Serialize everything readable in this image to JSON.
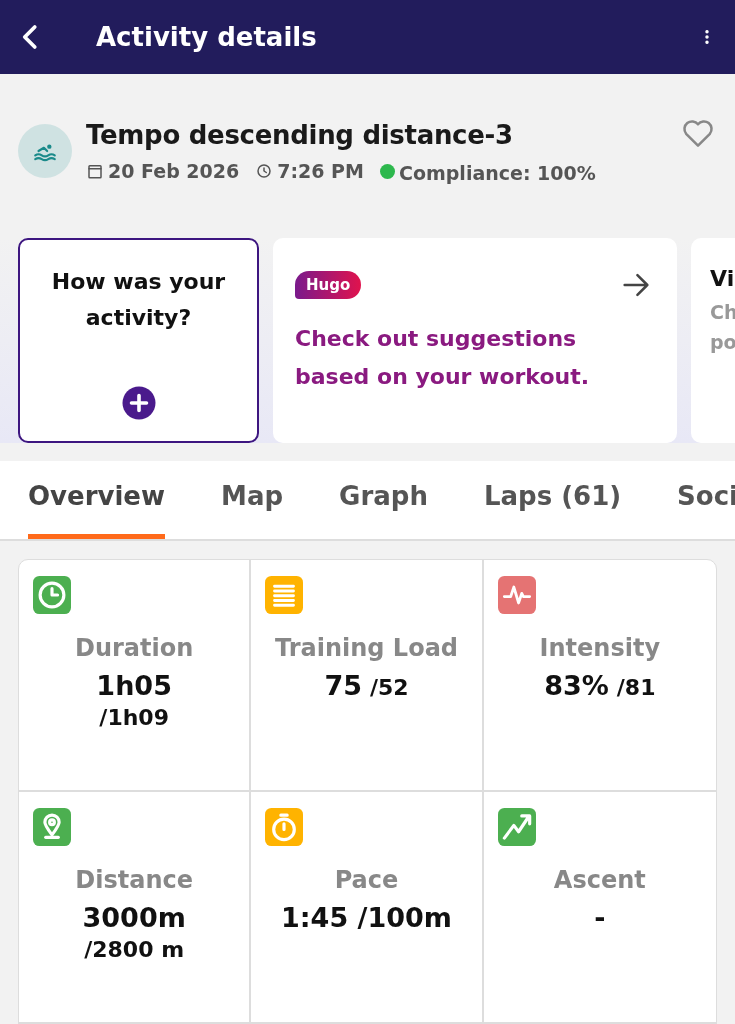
{
  "header": {
    "title": "Activity details"
  },
  "activity": {
    "title": "Tempo descending distance-3",
    "date": "20 Feb 2026",
    "time": "7:26 PM",
    "compliance": "Compliance: 100%",
    "favorite": false
  },
  "cards": [
    {
      "kind": "feedback",
      "title": "How was your activity?"
    },
    {
      "kind": "suggestion",
      "badge": "Hugo",
      "text": "Check out suggestions based on your workout."
    },
    {
      "kind": "partial",
      "title": "Vi",
      "lines": [
        "Ch",
        "po"
      ]
    }
  ],
  "tabs": [
    {
      "label": "Overview",
      "selected": true
    },
    {
      "label": "Map",
      "selected": false
    },
    {
      "label": "Graph",
      "selected": false
    },
    {
      "label": "Laps (61)",
      "selected": false
    },
    {
      "label": "Soci",
      "selected": false
    }
  ],
  "metrics": [
    {
      "color": "#4caf50",
      "label": "Duration",
      "value": "1h05",
      "target": "/1h09",
      "kind": "stacked"
    },
    {
      "color": "#ffb300",
      "label": "Training Load",
      "value": "75",
      "target": "/52",
      "kind": "inline"
    },
    {
      "color": "#e57373",
      "label": "Intensity",
      "value": "83%",
      "target": "/81",
      "kind": "inline"
    },
    {
      "color": "#4caf50",
      "label": "Distance",
      "value": "3000m",
      "target": "/2800 m",
      "kind": "stacked"
    },
    {
      "color": "#ffb300",
      "label": "Pace",
      "value": "1:45 /100m",
      "kind": "inline"
    },
    {
      "color": "#4caf50",
      "label": "Ascent",
      "value": "-",
      "kind": "inline"
    }
  ]
}
